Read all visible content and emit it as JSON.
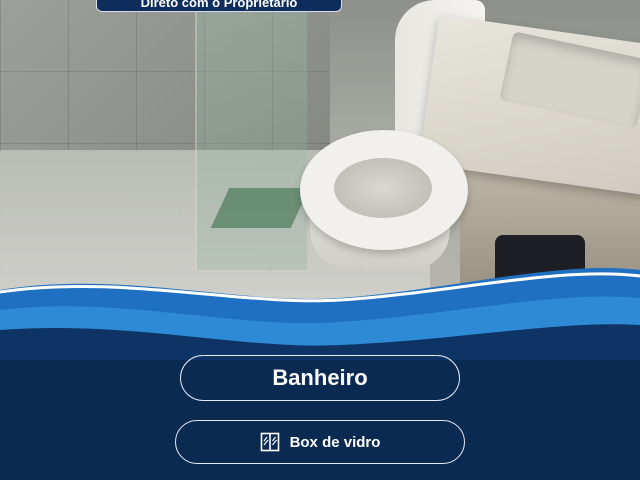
{
  "banner": {
    "text": "Direto com o Proprietário"
  },
  "room": {
    "title": "Banheiro"
  },
  "feature": {
    "icon": "glass-shower-box-icon",
    "label": "Box de vidro"
  },
  "colors": {
    "navy": "#0b2a52",
    "wave_blue": "#1f6fc2",
    "wave_light": "#3aa0e6",
    "white": "#ffffff"
  }
}
